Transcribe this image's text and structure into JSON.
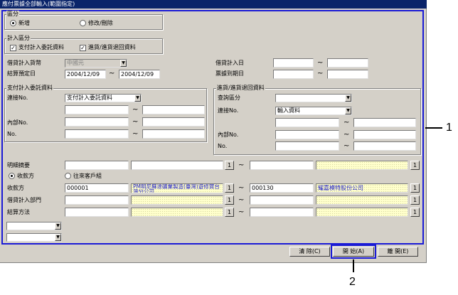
{
  "title": "應付票據全部輸入(範圍指定)",
  "kubun": {
    "legend": "區分",
    "new": "新增",
    "modify": "修改/刪除"
  },
  "keisan": {
    "legend": "計入區分",
    "c1": "支付計入委託資料",
    "c2": "進貨/進貨退回資料"
  },
  "fields": {
    "currency_label": "借貸計入貨幣",
    "currency_value": "中國元",
    "settle_label": "結算預定日",
    "settle_from": "2004/12/09",
    "settle_to": "2004/12/09",
    "keisan_date_label": "借貸計入日",
    "due_date_label": "票據到期日"
  },
  "shiharai": {
    "legend": "支付計入委託資料",
    "renketsu_label": "連接No.",
    "renketsu_value": "支付計入委託資料",
    "naibu_label": "內部No.",
    "no_label": "No."
  },
  "shiire": {
    "legend": "進貨/進貨退回資料",
    "shokai_label": "查詢區分",
    "renketsu_label": "連接No.",
    "renketsu_value": "輸入資料",
    "naibu_label": "內部No.",
    "no_label": "No."
  },
  "lower": {
    "meisai_label": "明細摘要",
    "radio_shuno": "收款方",
    "radio_ourai": "往來客戶組",
    "shuno_label": "收款方",
    "shuno_from_code": "000001",
    "shuno_from_name": "PM明尼蘇達礦業製造(臺灣)遊修賀台灣分公司",
    "shuno_to_code": "000130",
    "shuno_to_name": "耀嘉模特股份公司",
    "bumon_label": "借貸計入部門",
    "kessai_label": "結算方法",
    "one": "1"
  },
  "buttons": {
    "clear": "清 除(C)",
    "start": "開 始(A)",
    "close": "離 開(E)"
  },
  "callouts": {
    "c1": "1",
    "c2": "2"
  },
  "tilde": "~"
}
